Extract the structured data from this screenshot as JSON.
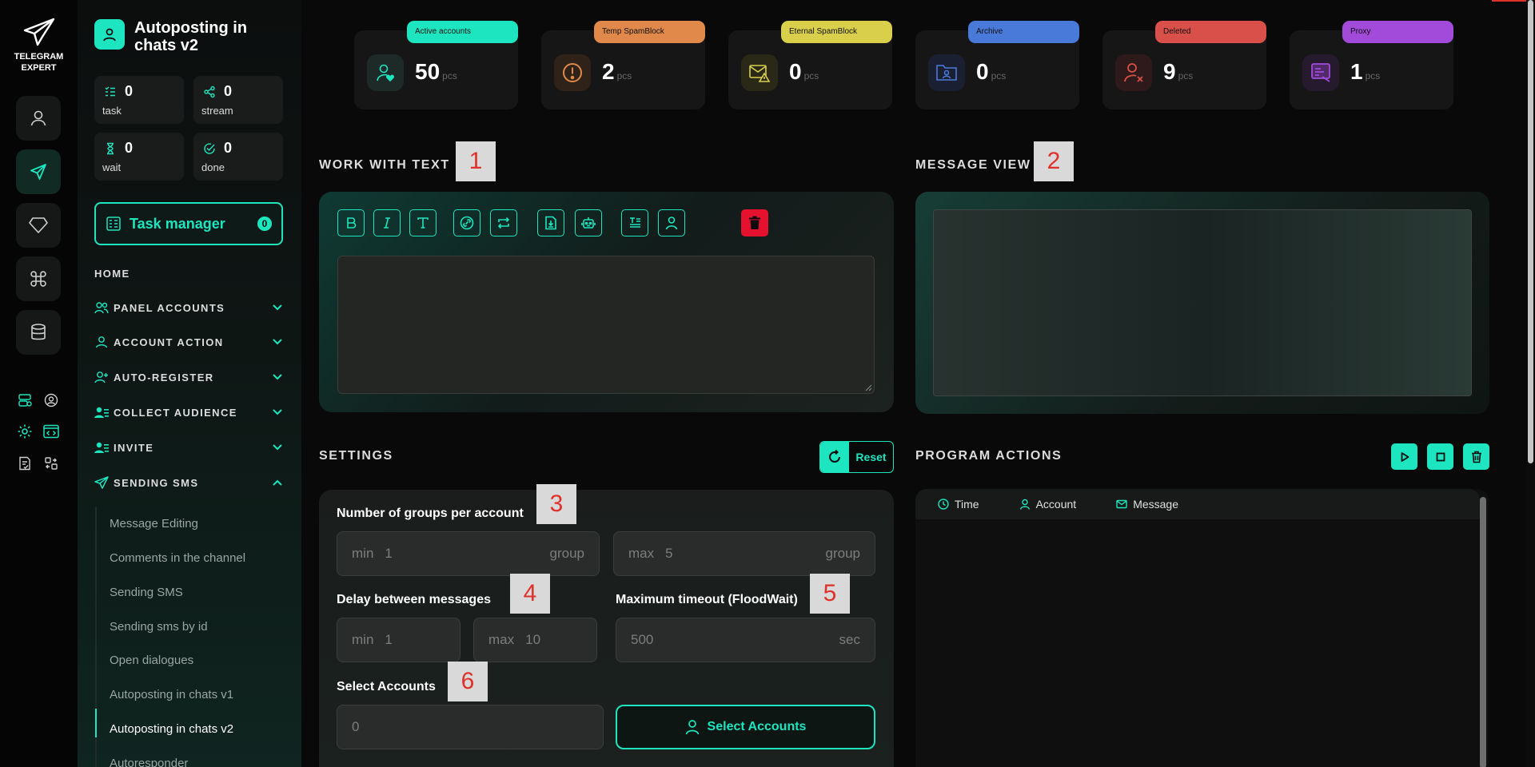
{
  "app": {
    "logo_line1": "TELEGRAM",
    "logo_line2": "EXPERT",
    "accent": "#1de5bf"
  },
  "sidebar": {
    "title": "Autoposting in chats v2",
    "stats": [
      {
        "value": "0",
        "label": "task",
        "icon": "checklist-icon"
      },
      {
        "value": "0",
        "label": "stream",
        "icon": "share-icon"
      },
      {
        "value": "0",
        "label": "wait",
        "icon": "hourglass-icon"
      },
      {
        "value": "0",
        "label": "done",
        "icon": "check-circle-icon"
      }
    ],
    "task_manager": {
      "label": "Task manager",
      "count": "0"
    },
    "home": "HOME",
    "nav": [
      {
        "label": "PANEL ACCOUNTS",
        "icon": "users-icon",
        "expanded": false
      },
      {
        "label": "ACCOUNT ACTION",
        "icon": "user-icon",
        "expanded": false
      },
      {
        "label": "AUTO-REGISTER",
        "icon": "user-plus-icon",
        "expanded": false
      },
      {
        "label": "COLLECT AUDIENCE",
        "icon": "user-list-icon",
        "expanded": false
      },
      {
        "label": "INVITE",
        "icon": "user-list-icon",
        "expanded": false
      },
      {
        "label": "SENDING SMS",
        "icon": "send-icon",
        "expanded": true
      }
    ],
    "sub_items": [
      "Message Editing",
      "Comments in the channel",
      "Sending SMS",
      "Sending sms by id",
      "Open dialogues",
      "Autoposting in chats v1",
      "Autoposting in chats v2",
      "Autoresponder"
    ],
    "active_sub": "Autoposting in chats v2"
  },
  "cards": [
    {
      "tag": "Active accounts",
      "value": "50",
      "unit": "pcs",
      "color": "#1de5bf",
      "icon": "user-heart-icon"
    },
    {
      "tag": "Temp SpamBlock",
      "value": "2",
      "unit": "pcs",
      "color": "#e0894a",
      "icon": "alert-circle-icon"
    },
    {
      "tag": "Eternal SpamBlock",
      "value": "0",
      "unit": "pcs",
      "color": "#d9cf4a",
      "icon": "mail-warning-icon"
    },
    {
      "tag": "Archive",
      "value": "0",
      "unit": "pcs",
      "color": "#4a7ad9",
      "icon": "folder-user-icon"
    },
    {
      "tag": "Deleted",
      "value": "9",
      "unit": "pcs",
      "color": "#d9504a",
      "icon": "user-x-icon"
    },
    {
      "tag": "Proxy",
      "value": "1",
      "unit": "pcs",
      "color": "#a24ad9",
      "icon": "proxy-icon"
    }
  ],
  "work_with_text": {
    "title": "WORK WITH TEXT",
    "marker": "1",
    "toolbar": [
      "bold-icon",
      "italic-icon",
      "text-icon",
      "link-icon",
      "repeat-icon",
      "file-import-icon",
      "robot-icon",
      "text-block-icon",
      "user-icon",
      "trash-icon"
    ]
  },
  "message_view": {
    "title": "MESSAGE VIEW",
    "marker": "2"
  },
  "settings": {
    "title": "SETTINGS",
    "reset_label": "Reset",
    "groups": {
      "label": "Number of groups per account",
      "marker": "3",
      "min_prefix": "min",
      "min_value": "1",
      "max_prefix": "max",
      "max_value": "5",
      "unit": "group"
    },
    "delay": {
      "label": "Delay between messages",
      "marker": "4",
      "min_prefix": "min",
      "min_value": "1",
      "max_prefix": "max",
      "max_value": "10"
    },
    "timeout": {
      "label": "Maximum timeout (FloodWait)",
      "marker": "5",
      "value": "500",
      "unit": "sec"
    },
    "accounts": {
      "label": "Select Accounts",
      "marker": "6",
      "value": "0",
      "button": "Select Accounts"
    }
  },
  "program_actions": {
    "title": "PROGRAM ACTIONS",
    "columns": [
      "Time",
      "Account",
      "Message"
    ]
  }
}
